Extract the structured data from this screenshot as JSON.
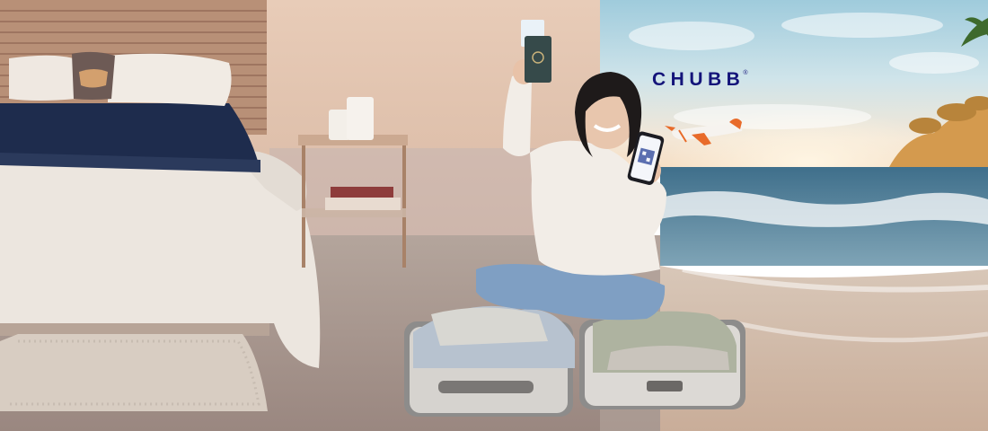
{
  "brand": {
    "logo_text": "CHUBB",
    "registered_mark": "®",
    "color": "#14147a"
  },
  "scene": {
    "description_icons": [
      "bed",
      "nightstand",
      "woman-with-passport",
      "phone-qr",
      "suitcase",
      "airplane",
      "beach",
      "palm-tree"
    ],
    "colors": {
      "wall": "#e2c3ae",
      "sky": "#b9d9e4",
      "sea": "#4f7f97",
      "sand": "#d9c4b3",
      "floor": "#a5938a"
    }
  }
}
